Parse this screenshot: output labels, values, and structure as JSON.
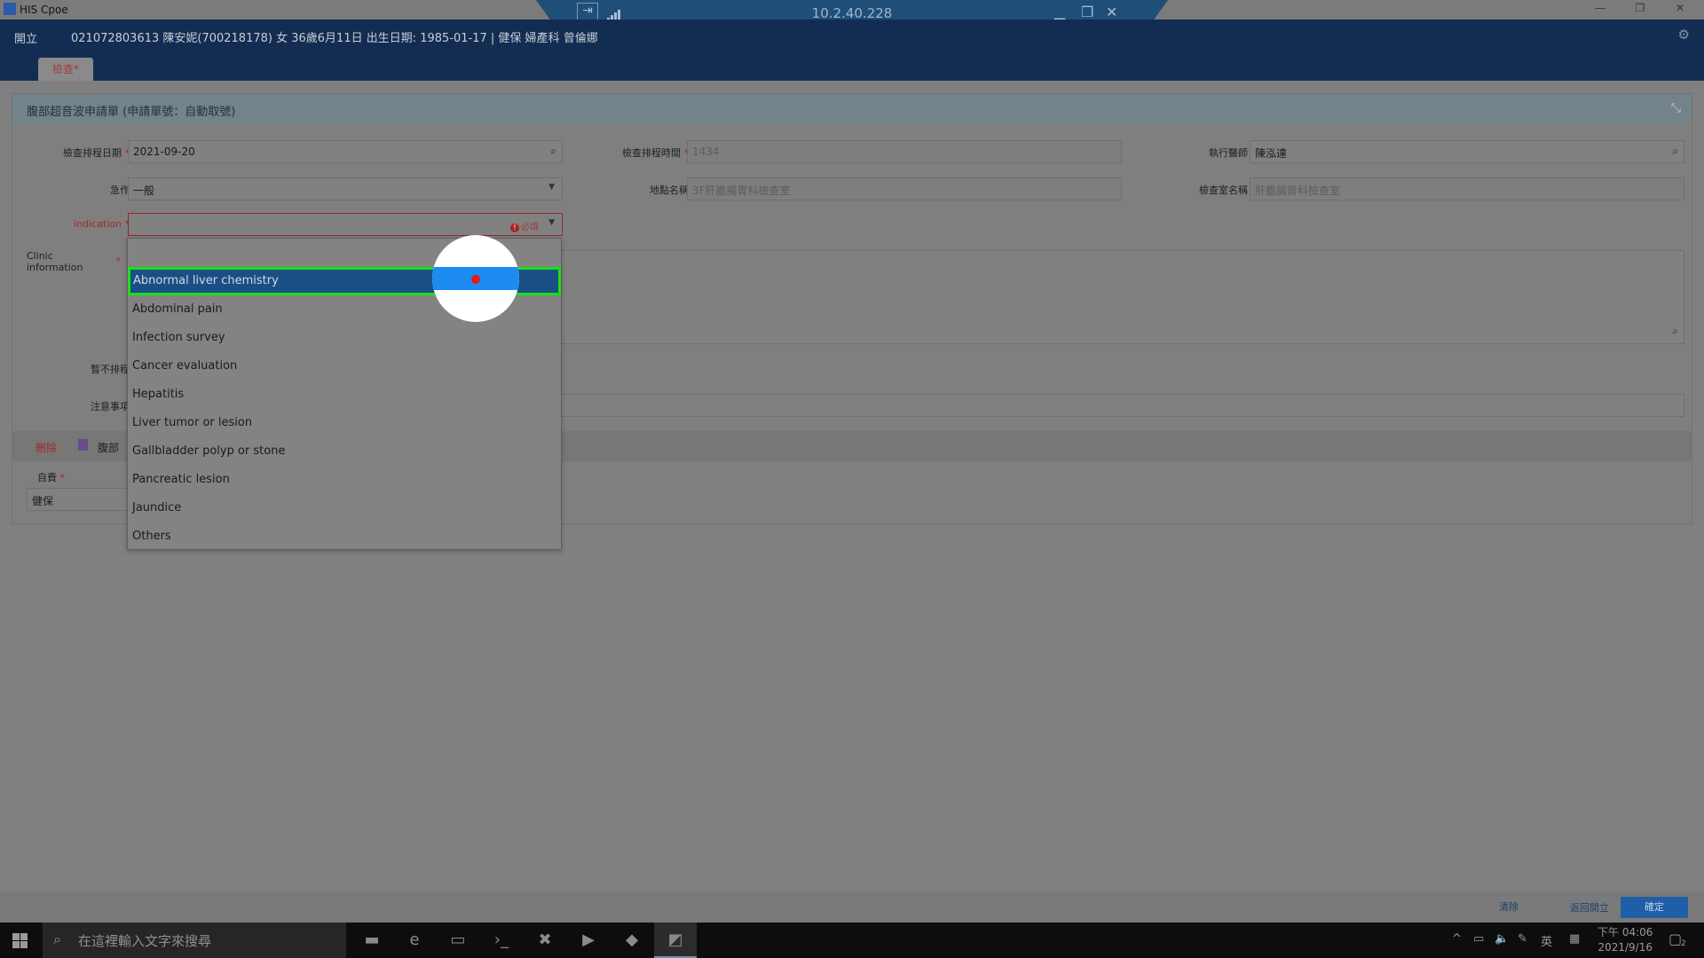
{
  "window": {
    "title": "HIS Cpoe",
    "rdp_address": "10.2.40.228"
  },
  "patient_bar": {
    "open_label": "開立",
    "patient_info": "021072803613 陳安妮(700218178) 女 36歲6月11日 出生日期: 1985-01-17 | 健保 婦產科 曾倫娜",
    "tab_label": "檢查*"
  },
  "form": {
    "header": "腹部超音波申請單 (申請單號：自動取號)",
    "exam_date": {
      "label": "檢查排程日期",
      "value": "2021-09-20"
    },
    "exam_time": {
      "label": "檢查排程時間",
      "value": "1434"
    },
    "doctor": {
      "label": "執行醫師",
      "value": "陳泓達"
    },
    "urgency": {
      "label": "急作",
      "value": "一般"
    },
    "location": {
      "label": "地點名稱",
      "value": "3F肝膽腸胃科檢查室"
    },
    "room": {
      "label": "檢查室名稱",
      "value": "肝膽腸胃科檢查室"
    },
    "indication": {
      "label": "indication",
      "value": "",
      "required_hint": "必填"
    },
    "clinic_info": {
      "label_line1": "Clinic",
      "label_line2": "information"
    },
    "no_schedule": {
      "label": "暫不排程"
    },
    "notes": {
      "label": "注意事項"
    },
    "section": {
      "delete_label": "刪除",
      "title": "腹部"
    },
    "self_pay": {
      "label": "自費",
      "value": "健保"
    },
    "required_marker": "*"
  },
  "dropdown": {
    "options": [
      "Abnormal liver chemistry",
      "Abdominal pain",
      "Infection survey",
      "Cancer evaluation",
      "Hepatitis",
      "Liver tumor or lesion",
      "Gallbladder polyp or stone",
      "Pancreatic lesion",
      "Jaundice",
      "Others"
    ],
    "selected_index": 0
  },
  "footer": {
    "clear_label": "清除",
    "back_label": "返回開立",
    "confirm_label": "確定"
  },
  "taskbar": {
    "search_placeholder": "在這裡輸入文字來搜尋",
    "ime_label": "英",
    "time": "下午 04:06",
    "date": "2021/9/16",
    "notification_count": "2"
  },
  "colors": {
    "header_bar": "#132d52",
    "selected_item": "#1a4f85",
    "highlight_border": "#18e018",
    "required": "#a42828",
    "confirm_button": "#1f5fa8"
  }
}
